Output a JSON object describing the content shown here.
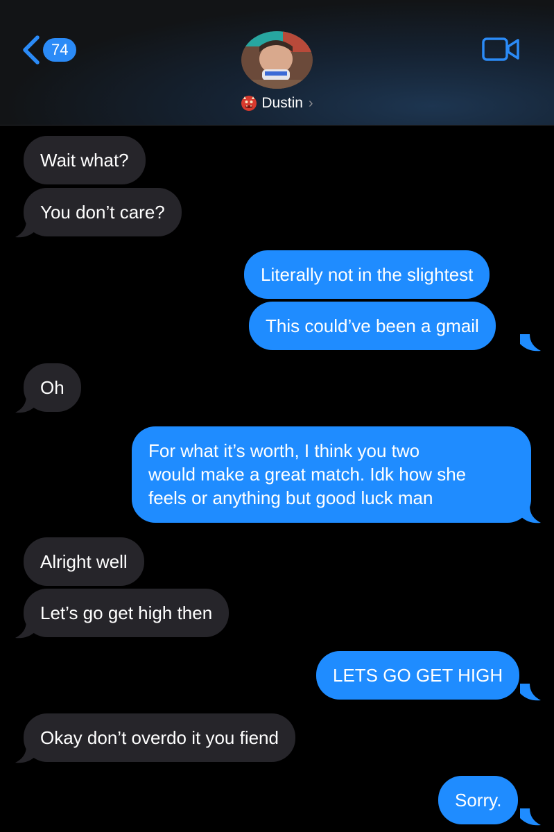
{
  "header": {
    "back_count": "74",
    "contact_name": "Dustin",
    "contact_emoji_icon": "ogre-face-icon",
    "video_icon": "video-camera-icon",
    "accent": "#2b8bf7"
  },
  "messages": [
    {
      "from": "them",
      "text": "Wait what?"
    },
    {
      "from": "them",
      "text": "You don’t care?"
    },
    {
      "from": "me",
      "text": "Literally not in the slightest"
    },
    {
      "from": "me",
      "text": "This could’ve been a gmail"
    },
    {
      "from": "them",
      "text": "Oh"
    },
    {
      "from": "me",
      "lines": [
        "For what it’s worth, I think you two",
        "would make a great match. Idk how she",
        "feels or anything but good luck man"
      ]
    },
    {
      "from": "them",
      "text": "Alright well"
    },
    {
      "from": "them",
      "text": "Let’s go get high then"
    },
    {
      "from": "me",
      "text": "LETS GO GET HIGH"
    },
    {
      "from": "them",
      "text": "Okay don’t overdo it you fiend"
    },
    {
      "from": "me",
      "text": "Sorry."
    }
  ],
  "colors": {
    "incoming_bubble": "#26252a",
    "outgoing_bubble": "#1f8cff",
    "background": "#000000"
  }
}
